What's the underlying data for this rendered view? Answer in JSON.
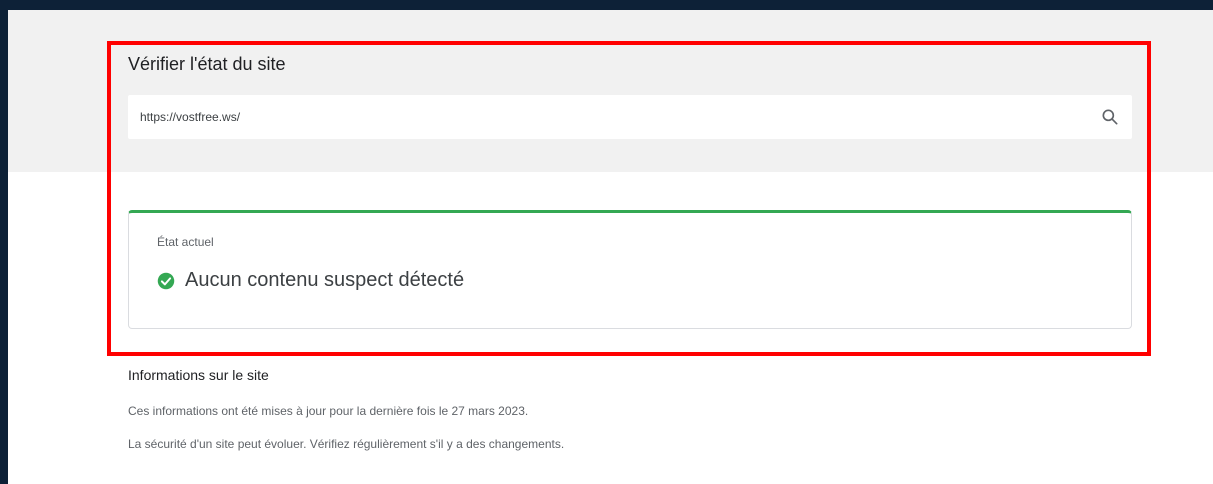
{
  "site_status": {
    "title": "Vérifier l'état du site",
    "search": {
      "value": "https://vostfree.ws/",
      "icon": "search-icon"
    }
  },
  "current_state": {
    "label": "État actuel",
    "status_text": "Aucun contenu suspect détecté",
    "status_icon": "check-circle-icon",
    "status_color": "#34a853"
  },
  "site_info": {
    "title": "Informations sur le site",
    "updated_text": "Ces informations ont été mises à jour pour la dernière fois le 27 mars 2023.",
    "advice_text": "La sécurité d'un site peut évoluer. Vérifiez régulièrement s'il y a des changements."
  },
  "colors": {
    "background": "#0d2137",
    "highlight": "#ff0000",
    "accent_green": "#34a853"
  }
}
